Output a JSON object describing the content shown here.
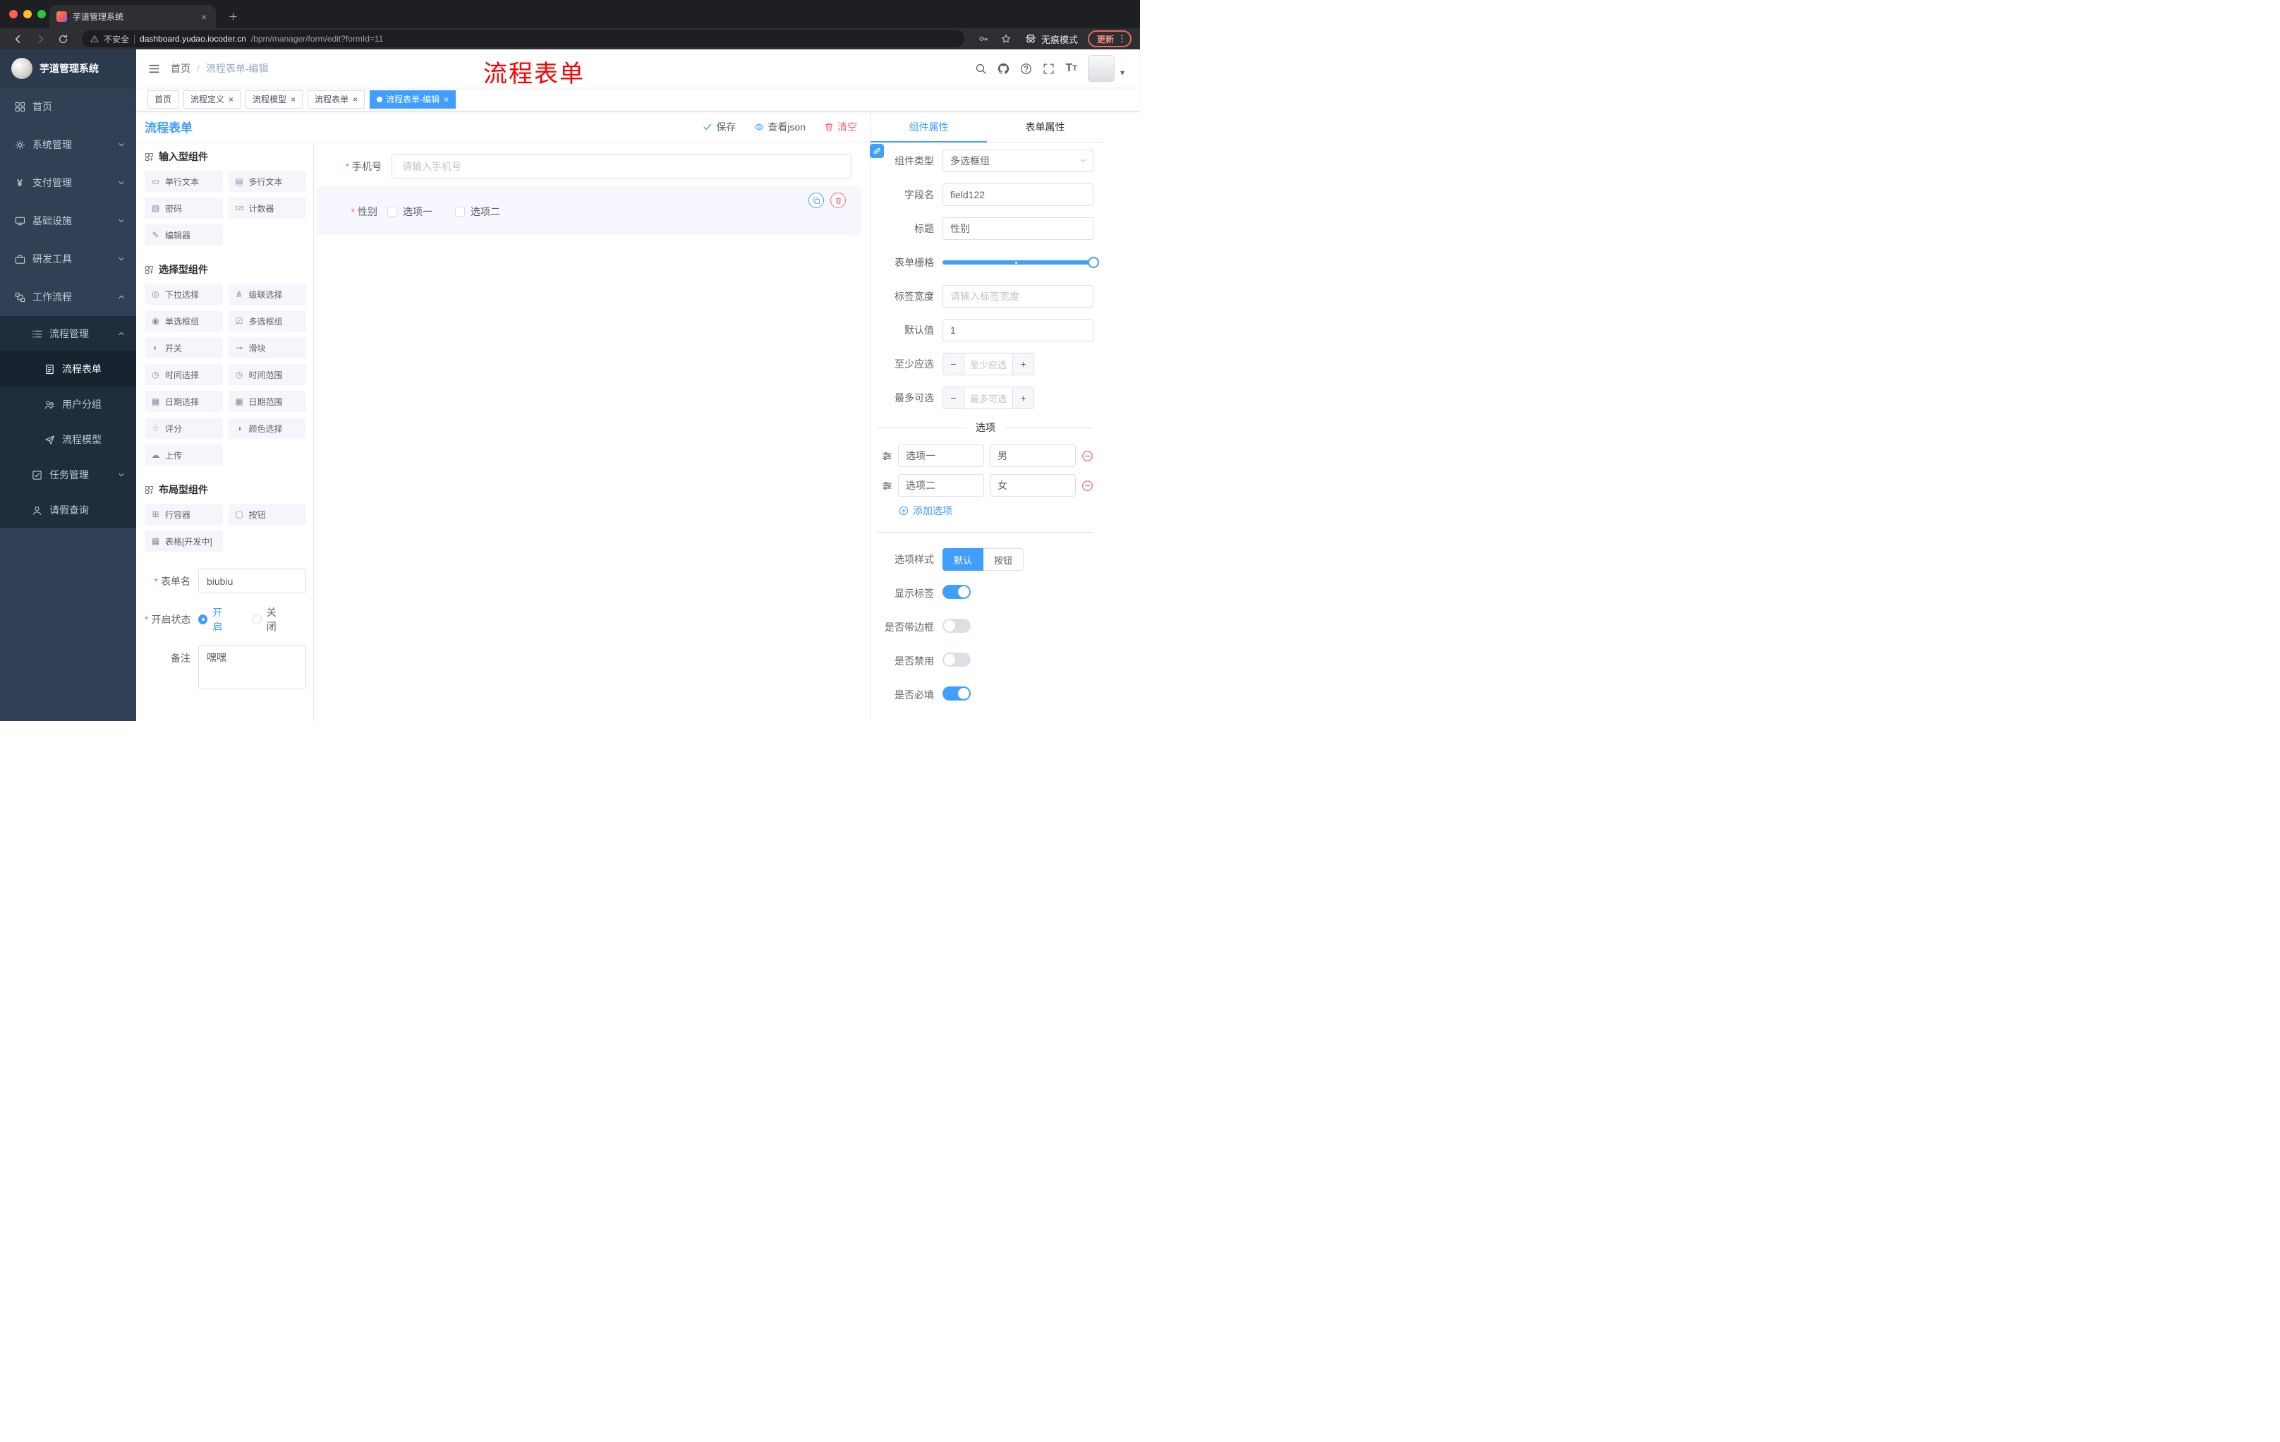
{
  "colors": {
    "accent": "#409EFF",
    "danger": "#F56C6C",
    "sidebar_bg": "#304156",
    "annotation_red": "#FF0000"
  },
  "browser": {
    "tab_title": "芋道管理系统",
    "security_label": "不安全",
    "url_host": "dashboard.yudao.iocoder.cn",
    "url_path": "/bpm/manager/form/edit?formId=11",
    "incognito_label": "无痕模式",
    "update_label": "更新"
  },
  "annotation": {
    "text": "流程表单"
  },
  "sidebar": {
    "logo_title": "芋道管理系统",
    "items": [
      {
        "id": "home",
        "label": "首页",
        "icon": "dashboard",
        "level": 1
      },
      {
        "id": "system",
        "label": "系统管理",
        "icon": "gear",
        "level": 1,
        "arrow": "down"
      },
      {
        "id": "payment",
        "label": "支付管理",
        "icon": "yen",
        "level": 1,
        "arrow": "down"
      },
      {
        "id": "infra",
        "label": "基础设施",
        "icon": "infra",
        "level": 1,
        "arrow": "down"
      },
      {
        "id": "devtools",
        "label": "研发工具",
        "icon": "tools",
        "level": 1,
        "arrow": "down"
      },
      {
        "id": "workflow",
        "label": "工作流程",
        "icon": "workflow",
        "level": 1,
        "arrow": "up"
      },
      {
        "id": "process-mgmt",
        "label": "流程管理",
        "icon": "list",
        "level": 2,
        "arrow": "up"
      },
      {
        "id": "process-form",
        "label": "流程表单",
        "icon": "form",
        "level": 3,
        "active": true
      },
      {
        "id": "user-group",
        "label": "用户分组",
        "icon": "people",
        "level": 3
      },
      {
        "id": "process-model",
        "label": "流程模型",
        "icon": "send",
        "level": 3
      },
      {
        "id": "task-mgmt",
        "label": "任务管理",
        "icon": "tasks",
        "level": 2,
        "arrow": "down"
      },
      {
        "id": "leave-query",
        "label": "请假查询",
        "icon": "user",
        "level": 2
      }
    ]
  },
  "navbar": {
    "breadcrumb_home": "首页",
    "breadcrumb_sep": "/",
    "breadcrumb_current": "流程表单-编辑"
  },
  "tags": [
    {
      "label": "首页",
      "closable": false,
      "active": false
    },
    {
      "label": "流程定义",
      "closable": true,
      "active": false
    },
    {
      "label": "流程模型",
      "closable": true,
      "active": false
    },
    {
      "label": "流程表单",
      "closable": true,
      "active": false
    },
    {
      "label": "流程表单-编辑",
      "closable": true,
      "active": true
    }
  ],
  "designer": {
    "title": "流程表单",
    "actions": {
      "save": "保存",
      "view_json": "查看json",
      "clear": "清空"
    },
    "component_groups": [
      {
        "title": "输入型组件",
        "items": [
          {
            "label": "单行文本",
            "icon": "single-text"
          },
          {
            "label": "多行文本",
            "icon": "multi-text"
          },
          {
            "label": "密码",
            "icon": "password"
          },
          {
            "label": "计数器",
            "icon": "counter"
          },
          {
            "label": "编辑器",
            "icon": "editor"
          }
        ]
      },
      {
        "title": "选择型组件",
        "items": [
          {
            "label": "下拉选择",
            "icon": "select"
          },
          {
            "label": "级联选择",
            "icon": "cascader"
          },
          {
            "label": "单选框组",
            "icon": "radio-group"
          },
          {
            "label": "多选框组",
            "icon": "checkbox-group"
          },
          {
            "label": "开关",
            "icon": "switch"
          },
          {
            "label": "滑块",
            "icon": "slider"
          },
          {
            "label": "时间选择",
            "icon": "time"
          },
          {
            "label": "时间范围",
            "icon": "time-range"
          },
          {
            "label": "日期选择",
            "icon": "date"
          },
          {
            "label": "日期范围",
            "icon": "date-range"
          },
          {
            "label": "评分",
            "icon": "rate"
          },
          {
            "label": "颜色选择",
            "icon": "color"
          },
          {
            "label": "上传",
            "icon": "upload"
          }
        ]
      },
      {
        "title": "布局型组件",
        "items": [
          {
            "label": "行容器",
            "icon": "row"
          },
          {
            "label": "按钮",
            "icon": "button"
          },
          {
            "label": "表格[开发中]",
            "icon": "table"
          }
        ]
      }
    ],
    "meta": {
      "form_name_label": "表单名",
      "form_name_value": "biubiu",
      "status_label": "开启状态",
      "status_on": "开启",
      "status_off": "关闭",
      "remark_label": "备注",
      "remark_value": "嘿嘿"
    },
    "canvas": {
      "phone": {
        "label": "手机号",
        "placeholder": "请输入手机号"
      },
      "gender": {
        "label": "性别",
        "option1": "选项一",
        "option2": "选项二"
      }
    }
  },
  "properties": {
    "tab_component": "组件属性",
    "tab_form": "表单属性",
    "component_type_label": "组件类型",
    "component_type_value": "多选框组",
    "field_name_label": "字段名",
    "field_name_value": "field122",
    "title_label": "标题",
    "title_value": "性别",
    "grid_label": "表单栅格",
    "label_width_label": "标签宽度",
    "label_width_placeholder": "请输入标签宽度",
    "default_label": "默认值",
    "default_value": "1",
    "min_label": "至少应选",
    "min_placeholder": "至少应选",
    "max_label": "最多可选",
    "max_placeholder": "最多可选",
    "options_title": "选项",
    "options": [
      {
        "label": "选项一",
        "value": "男"
      },
      {
        "label": "选项二",
        "value": "女"
      }
    ],
    "add_option_label": "添加选项",
    "option_style_label": "选项样式",
    "option_style_default": "默认",
    "option_style_button": "按钮",
    "toggles": [
      {
        "label": "显示标签",
        "on": true
      },
      {
        "label": "是否带边框",
        "on": false
      },
      {
        "label": "是否禁用",
        "on": false
      },
      {
        "label": "是否必填",
        "on": true
      }
    ]
  }
}
